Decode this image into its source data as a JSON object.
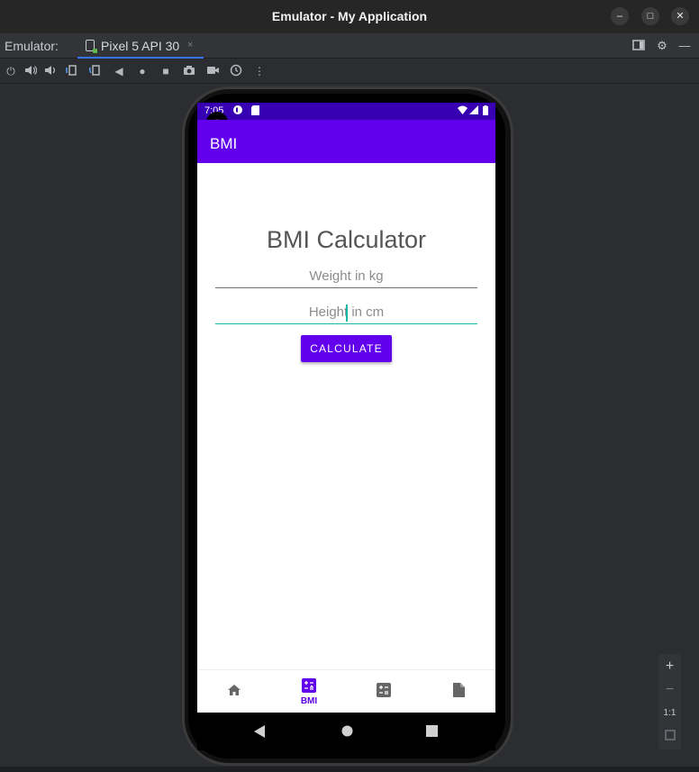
{
  "window": {
    "title": "Emulator - My Application",
    "controls": [
      "–",
      "□",
      "✕"
    ]
  },
  "tabrow": {
    "label": "Emulator:",
    "device_tab": "Pixel 5 API 30",
    "tab_close": "×"
  },
  "toolbar": {
    "icons": [
      "power-icon",
      "volume-up-icon",
      "volume-down-icon",
      "rotate-left-icon",
      "rotate-right-icon",
      "back-icon",
      "home-icon",
      "overview-icon",
      "screenshot-icon",
      "screen-record-icon",
      "snapshot-icon",
      "more-icon"
    ]
  },
  "device": {
    "status": {
      "time": "7:05"
    },
    "appbar": {
      "title": "BMI"
    },
    "heading": "BMI Calculator",
    "weight_field": {
      "placeholder": "Weight in kg"
    },
    "height_field": {
      "placeholder": "Height in cm"
    },
    "calculate_button": "CALCULATE",
    "accent_color": "#6200ee",
    "bottom_nav": [
      {
        "icon": "home-icon",
        "label": "",
        "active": false
      },
      {
        "icon": "calculator-icon",
        "label": "BMI",
        "active": true
      },
      {
        "icon": "calculator-icon",
        "label": "",
        "active": false
      },
      {
        "icon": "document-icon",
        "label": "",
        "active": false
      }
    ]
  },
  "zoom": {
    "zoom_in": "+",
    "zoom_out": "−",
    "actual_size": "1:1"
  }
}
